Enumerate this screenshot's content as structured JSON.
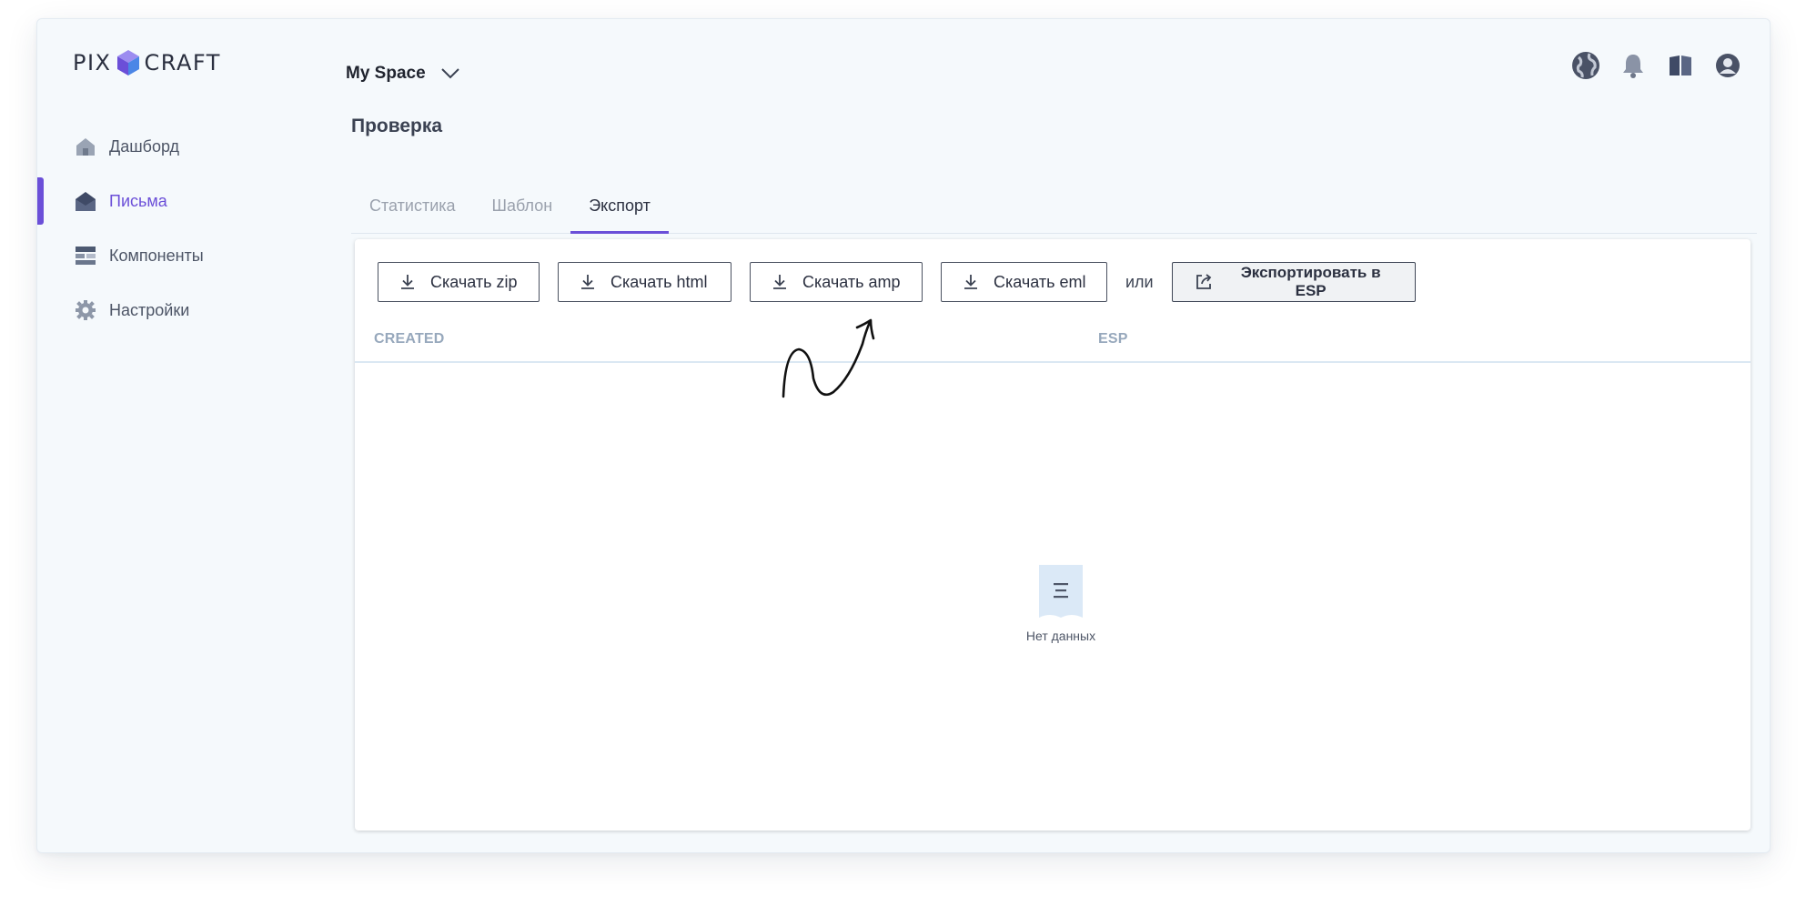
{
  "app": {
    "logo_left": "PIX",
    "logo_right": "CRAFT"
  },
  "sidebar": {
    "items": [
      {
        "label": "Дашборд",
        "icon": "home-icon",
        "active": false
      },
      {
        "label": "Письма",
        "icon": "envelope-icon",
        "active": true
      },
      {
        "label": "Компоненты",
        "icon": "components-icon",
        "active": false
      },
      {
        "label": "Настройки",
        "icon": "gear-icon",
        "active": false
      }
    ]
  },
  "header": {
    "space_name": "My Space",
    "icons": [
      "globe-icon",
      "bell-icon",
      "book-icon",
      "user-icon"
    ]
  },
  "page": {
    "title": "Проверка",
    "tabs": [
      {
        "label": "Статистика",
        "active": false
      },
      {
        "label": "Шаблон",
        "active": false
      },
      {
        "label": "Экспорт",
        "active": true
      }
    ]
  },
  "export": {
    "buttons": {
      "zip": "Скачать zip",
      "html": "Скачать html",
      "amp": "Скачать amp",
      "eml": "Скачать eml"
    },
    "or_label": "или",
    "esp_button": "Экспортировать в ESP"
  },
  "table": {
    "columns": [
      "CREATED",
      "ESP"
    ],
    "rows": [],
    "empty_text": "Нет данных"
  },
  "colors": {
    "accent": "#6b4fd8",
    "window_bg": "#f5f9fc",
    "header_text": "#97a8bc"
  }
}
